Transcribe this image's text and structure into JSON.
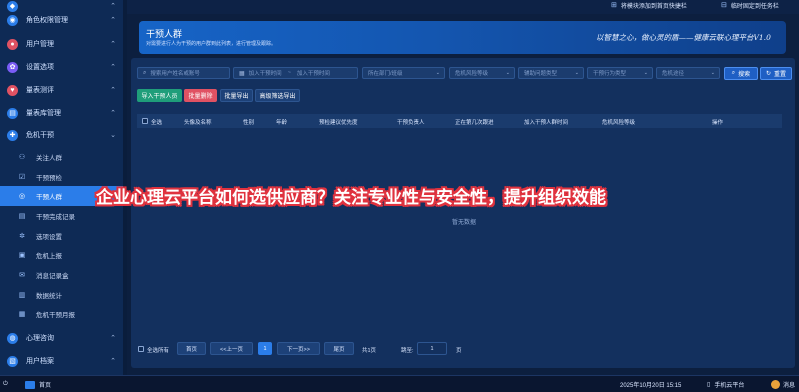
{
  "sidebar": {
    "items": [
      {
        "label": "",
        "icon": "shield-icon",
        "color": "#2b7de9",
        "chevron": "⌃"
      },
      {
        "label": "角色权限管理",
        "icon": "role-icon",
        "color": "#2b7de9",
        "chevron": "⌃"
      },
      {
        "label": "用户管理",
        "icon": "user-icon",
        "color": "#e05263",
        "chevron": "⌃"
      },
      {
        "label": "设置选项",
        "icon": "settings-icon",
        "color": "#7a5cf5",
        "chevron": "⌃"
      },
      {
        "label": "量表测评",
        "icon": "heart-icon",
        "color": "#e05263",
        "chevron": "⌃"
      },
      {
        "label": "量表库管理",
        "icon": "library-icon",
        "color": "#2b7de9",
        "chevron": "⌃"
      },
      {
        "label": "危机干预",
        "icon": "crisis-icon",
        "color": "#2b7de9",
        "chevron": "⌄"
      }
    ],
    "sub_items": [
      {
        "label": "关注人群",
        "icon": "people-icon"
      },
      {
        "label": "干预预检",
        "icon": "check-icon"
      },
      {
        "label": "干预人群",
        "icon": "intervene-icon"
      },
      {
        "label": "干预完成记录",
        "icon": "record-icon"
      },
      {
        "label": "选项设置",
        "icon": "gear-icon"
      },
      {
        "label": "危机上报",
        "icon": "report-icon"
      },
      {
        "label": "消息记录盒",
        "icon": "message-icon"
      },
      {
        "label": "数据统计",
        "icon": "stats-icon"
      },
      {
        "label": "危机干预月报",
        "icon": "monthly-report-icon"
      }
    ],
    "bottom_items": [
      {
        "label": "心理咨询",
        "icon": "consult-icon",
        "color": "#2b7de9",
        "chevron": "⌃"
      },
      {
        "label": "用户档案",
        "icon": "archive-icon",
        "color": "#2b7de9",
        "chevron": "⌃"
      }
    ]
  },
  "topbar": {
    "pin_label": "将模块添加到首页快捷栏",
    "fix_label": "临时固定到任务栏"
  },
  "banner": {
    "title": "干预人群",
    "subtitle": "对需要进行人为干预的用户群到此列表，进行管理及跟踪。",
    "slogan": "以智慧之心，做心灵的盾——健康云联心理平台V1.0"
  },
  "filters": {
    "search_placeholder": "搜索用户姓名或账号",
    "date_start_placeholder": "加入干预时间",
    "date_end_placeholder": "加入干预时间",
    "date_sep": "~",
    "dept_placeholder": "所在部门/班级",
    "risk_placeholder": "危机风险等级",
    "source_placeholder": "辅助问题类型",
    "status_placeholder": "干预行为类型",
    "channel_placeholder": "危机途径",
    "search_btn": "搜索",
    "reset_btn": "重置"
  },
  "actions": {
    "import_btn": "导入干预人员",
    "batch_delete_btn": "批量删除",
    "batch_export_btn": "批量导出",
    "advanced_export_btn": "高级筛选导出"
  },
  "table": {
    "headers": [
      "全选",
      "头像及名称",
      "性别",
      "年龄",
      "预检建议优先度",
      "干预负责人",
      "正在第几次跟进",
      "加入干预人群时间",
      "危机风险等级",
      "操作"
    ],
    "empty_text": "暂无数据"
  },
  "pagination": {
    "select_all": "全选所有",
    "first": "首页",
    "prev": "<<上一页",
    "current": "1",
    "next": "下一页>>",
    "last": "尾页",
    "total": "共1页",
    "jump_label": "跳至:",
    "jump_value": "1",
    "page_unit": "页"
  },
  "overlay": {
    "headline": "企业心理云平台如何选供应商？关注专业性与安全性，提升组织效能"
  },
  "taskbar": {
    "home_label": "首页",
    "datetime": "2025年10月20日 15:15",
    "mobile_label": "手机云平台",
    "message_label": "消息"
  },
  "colors": {
    "accent": "#2b7de9",
    "import_green": "#1f9e7a",
    "delete_red": "#e05263",
    "headline_outline": "#e0323e"
  }
}
